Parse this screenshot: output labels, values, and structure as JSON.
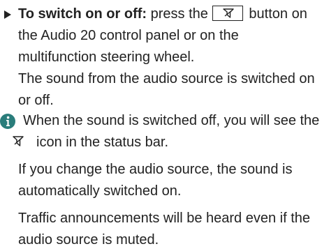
{
  "step": {
    "lead_bold": "To switch on or off:",
    "text_before_key": " press the",
    "text_after_key": " button on the Audio 20 control panel or on the multifunction steering wheel.",
    "result": "The sound from the audio source is switched on or off."
  },
  "note": {
    "icon": "info-icon",
    "para1_before_icon": "When the sound is switched off, you will see the",
    "para1_after_icon": "icon in the status bar.",
    "para2": "If you change the audio source, the sound is automatically switched on.",
    "para3": "Traffic announcements will be heard even if the audio source is muted."
  },
  "icons": {
    "mute_key_icon": "mute-icon",
    "status_icon": "mute-icon",
    "accent_color": "#2a7d7b"
  }
}
